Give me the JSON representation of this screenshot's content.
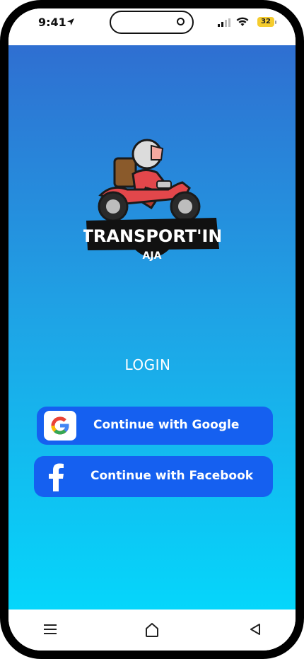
{
  "status_bar": {
    "time": "9:41",
    "battery": "32",
    "icons": [
      "location-arrow-icon",
      "signal-icon",
      "wifi-icon",
      "battery-icon"
    ]
  },
  "logo": {
    "line1": "TRANSPORT'IN",
    "line2": "AJA"
  },
  "login": {
    "title": "LOGIN",
    "google_label": "Continue with Google",
    "facebook_label": "Continue with Facebook"
  },
  "navbar": {
    "icons": [
      "menu-icon",
      "home-icon",
      "back-icon"
    ]
  },
  "colors": {
    "gradient_top": "#2f6fd1",
    "gradient_bottom": "#05d6fb",
    "button": "#1560f0"
  }
}
